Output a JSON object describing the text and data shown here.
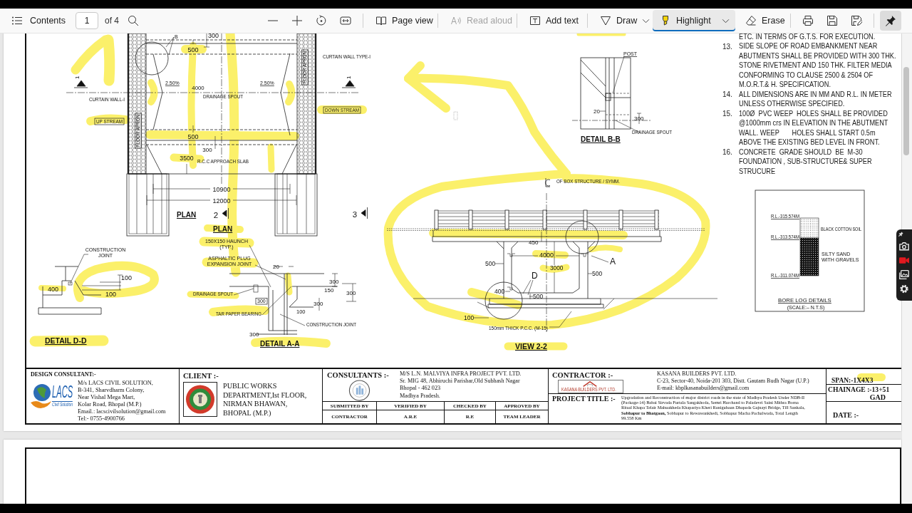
{
  "toolbar": {
    "contents_label": "Contents",
    "page_number": "1",
    "page_total": "of 4",
    "tools": [
      {
        "label": "Page view",
        "selected": false,
        "disabled": false
      },
      {
        "label": "Read aloud",
        "selected": false,
        "disabled": true
      },
      {
        "label": "Add text",
        "selected": false,
        "disabled": false
      },
      {
        "label": "Draw",
        "selected": false,
        "disabled": false
      },
      {
        "label": "Highlight",
        "selected": true,
        "disabled": false
      },
      {
        "label": "Erase",
        "selected": false,
        "disabled": false
      }
    ],
    "pinned": true
  },
  "plan": {
    "labels": [
      "300",
      "B",
      "500",
      "CURTAIN WALL TYPE-I",
      "1",
      "1",
      "2.50%",
      "4000",
      "DRAINAGE SPOUT",
      "2.50%",
      "CURTAIN WALL-I",
      "DOWN STREAM",
      "UP STREAM",
      "FLOOR APRON",
      "FLOOR APRON",
      "500",
      "300",
      "3500",
      "R.C.C APPROACH SLAB",
      "10900",
      "12000",
      "PLAN",
      "2",
      "3",
      "PLAN"
    ]
  },
  "detail_d_d": {
    "labels": [
      "CONSTRUCTION\nJOINT",
      "100",
      "400",
      "100",
      "DETAIL D-D"
    ]
  },
  "detail_a_a": {
    "labels": [
      "150X150 HAUNCH\n(TYP.)",
      "ASPHALTIC PLUG\nEXPANSION JOINT",
      "20",
      "300",
      "150",
      "300",
      "DRAINAGE SPOUT",
      "300",
      "300",
      "100",
      "TAR PAPER BEARING",
      "CONSTRUCTION JOINT",
      "300",
      "DETAIL A-A"
    ]
  },
  "detail_b_b": {
    "labels": [
      "POST",
      "20",
      "300",
      "DRAINAGE SPOUT",
      "DETAIL B-B"
    ]
  },
  "view_2_2": {
    "labels": [
      "OF BOX STRUCTURE / SYMM.",
      "450",
      "4000",
      "A",
      "500",
      "3000",
      "500",
      "D",
      "400",
      "500",
      "100",
      "150mm THICK P.C.C. (M-15)",
      "VIEW 2-2"
    ]
  },
  "notes": {
    "continuation": "ETC. IN TERMS OF G.T.S. FOR EXECUTION.",
    "items": [
      {
        "number": "13.",
        "text": "SIDE SLOPE OF ROAD EMBANKMENT NEAR\nABUTMENTS SHALL BE PROVIDED WITH 300 THK.\nSTONE RIVETMENT AND 150 THK. FILTER MEDIA\nCONFORMING TO CLAUSE 2500 & 2504 OF\nM.O.R.T.& H. SPECIFICATION."
      },
      {
        "number": "14.",
        "text": "ALL DIMENSIONS ARE IN MM AND R.L. IN METER\nUNLESS OTHERWISE SPECIFIED."
      },
      {
        "number": "15.",
        "text": "100Ø  PVC WEEP  HOLES SHALL BE PROVIDED\n@1000mm crs IN ELEVATION IN THE ABUTMENT\nWALL. WEEP       HOLES SHALL START 0.5m\nABOVE THE EXISTING BED LEVEL IN FRONT."
      },
      {
        "number": "16.",
        "text": "CONCRETE  GRADE SHOULD  BE  M-30\nFOUNDATION , SUB-STRUCTURE& SUPER\nSTRUCURE"
      }
    ]
  },
  "bore_log": {
    "labels": [
      "R.L.-315.574M",
      "BLACK COTTON SOIL",
      "R.L.-313.574M",
      "SILTY SAND\nWITH GRAVELS",
      "R.L.-311.074M",
      "BORE LOG DETAILS",
      "(SCALE:– N.T.S)"
    ]
  },
  "title_block": {
    "design_consultant": {
      "heading": "DESIGN CONSULTANT:-",
      "logo_name": "LACS",
      "logo_tagline": "Civil Solution",
      "address": "M/s LACS CIVIL SOLUTION,\nB-341, Sharvdharm Colony,\nNear Vishal Mega Mart,\nKolar Road, Bhopal (M.P.)\nEmail.: lacscivilsolution@gmail.com\nTel:- 0755-4900766"
    },
    "client": {
      "heading": "CLIENT :-",
      "address": "PUBLIC WORKS\nDEPARTMENT,Ist FLOOR,\nNIRMAN BHAWAN,\nBHOPAL (M.P.)"
    },
    "consultants": {
      "heading": "CONSULTANTS :-",
      "address": "M/S L.N. MALVIYA INFRA PROJECT PVT. LTD.\nSr. MIG 48, Abhiruchi Parishar,Old Subhash Nagar\nBhopal - 462 023\nMadhya Pradesh."
    },
    "signoff": [
      {
        "role": "SUBMITTED BY",
        "by": "CONTRACTOR"
      },
      {
        "role": "VERIFIED BY",
        "by": "A.R.E"
      },
      {
        "role": "CHECKED BY",
        "by": "R.E"
      },
      {
        "role": "APPROVED BY",
        "by": "TEAM LEADER"
      }
    ],
    "contractor": {
      "heading": "CONTRACTOR :-",
      "logo_text": "KASANA BUILDERS PVT. LTD.",
      "address": "KASANA BUILDERS PVT. LTD.\nC-23, Sector-40, Noida-201 303, Distt. Gautam Budh Nagar (U.P.)\nE-mail: kbplkasanabuilders@gmail.com"
    },
    "project_title": {
      "heading": "PROJECT TITLE :-",
      "text": "Upgradation and Reconstruction of major district roads in the state of Madhya Pradesh Under NDB-II\n(Package-14) Babai Sirvada Furtala Sangakhoda, Semri Harchand to Paladevri Saini Mithra Borna\nRitaal Khapa Telair Mahuakheda Khapariya Kheri Raniguhaan Dhapada Gajnayi Bridge, Till Sankala,\n**Sobhapur to Bhatgaon,** Sobhapur to Rewawankhedi, Sobhapur Macha Pachalwada, Total Length\n99.558 Km"
    },
    "span": "SPAN:-1X4X3",
    "chainage": "CHAINAGE :-13+51",
    "drawing_type": "GAD",
    "date": "DATE :-"
  }
}
